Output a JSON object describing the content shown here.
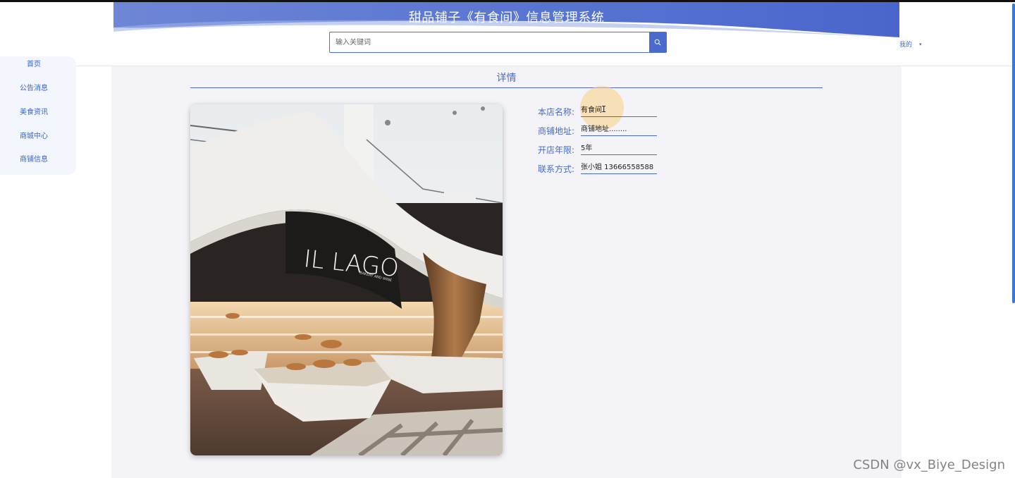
{
  "header": {
    "title": "甜品铺子《有食间》信息管理系统",
    "search_placeholder": "输入关键词",
    "user_menu_label": "我的"
  },
  "sidebar": {
    "items": [
      {
        "label": "首页"
      },
      {
        "label": "公告消息"
      },
      {
        "label": "美食资讯"
      },
      {
        "label": "商城中心"
      },
      {
        "label": "商铺信息"
      }
    ]
  },
  "detail": {
    "title": "详情",
    "photo_sign_text": "IL LAGO",
    "photo_subtext": "BAKERY AND WINE",
    "fields": [
      {
        "label": "本店名称:",
        "value": "有食间"
      },
      {
        "label": "商铺地址:",
        "value": "商铺地址........"
      },
      {
        "label": "开店年限:",
        "value": "5年"
      },
      {
        "label": "联系方式:",
        "value": "张小姐 13666558588"
      }
    ]
  },
  "watermark": "CSDN @vx_Biye_Design",
  "colors": {
    "accent": "#4a6acd",
    "banner_dark": "#4a6acd",
    "content_bg": "#f4f4f8"
  }
}
